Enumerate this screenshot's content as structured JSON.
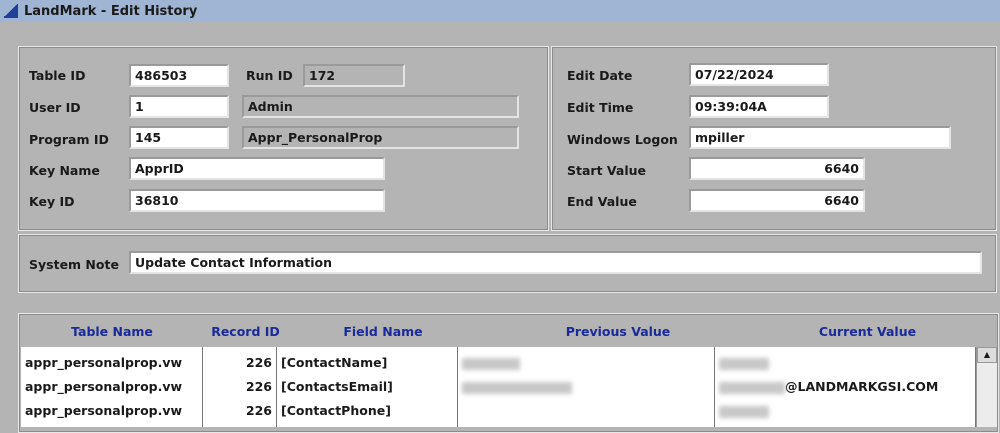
{
  "window": {
    "title": "LandMark - Edit History"
  },
  "fields": {
    "table_id": {
      "label": "Table ID",
      "value": "486503"
    },
    "run_id": {
      "label": "Run ID",
      "value": "172"
    },
    "user_id": {
      "label": "User ID",
      "value": "1",
      "name": "Admin"
    },
    "program_id": {
      "label": "Program ID",
      "value": "145",
      "name": "Appr_PersonalProp"
    },
    "key_name": {
      "label": "Key Name",
      "value": "ApprID"
    },
    "key_id": {
      "label": "Key ID",
      "value": "36810"
    },
    "edit_date": {
      "label": "Edit Date",
      "value": "07/22/2024"
    },
    "edit_time": {
      "label": "Edit Time",
      "value": "09:39:04A"
    },
    "windows_logon": {
      "label": "Windows Logon",
      "value": "mpiller"
    },
    "start_value": {
      "label": "Start Value",
      "value": "6640"
    },
    "end_value": {
      "label": "End Value",
      "value": "6640"
    },
    "system_note": {
      "label": "System Note",
      "value": "Update Contact Information"
    }
  },
  "table": {
    "headers": [
      "Table Name",
      "Record ID",
      "Field Name",
      "Previous Value",
      "Current Value"
    ],
    "rows": [
      {
        "table": "appr_personalprop.vw",
        "record": "226",
        "field": "[ContactName]",
        "current": ""
      },
      {
        "table": "appr_personalprop.vw",
        "record": "226",
        "field": "[ContactsEmail]",
        "current": "@LANDMARKGSI.COM"
      },
      {
        "table": "appr_personalprop.vw",
        "record": "226",
        "field": "[ContactPhone]",
        "current": ""
      }
    ]
  }
}
